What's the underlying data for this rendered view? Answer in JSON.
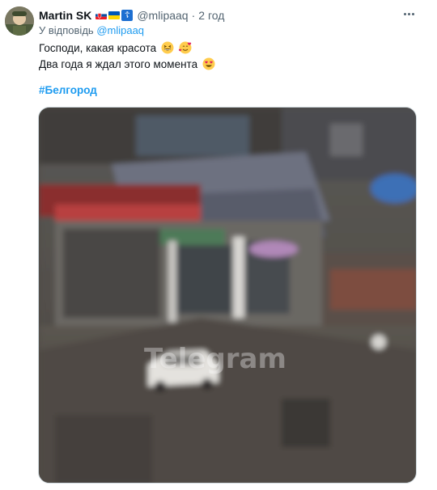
{
  "tweet": {
    "author": {
      "display_name": "Martin SK",
      "handle": "@mlipaaq",
      "avatar_icon": "avatar-photo",
      "badges": [
        "slovakia-flag-icon",
        "ukraine-flag-icon",
        "orthodox-cross-icon"
      ]
    },
    "separator": "·",
    "timestamp": "2 год",
    "reply": {
      "prefix": "У відповідь",
      "to": "@mlipaaq"
    },
    "text": {
      "line1": "Господи, какая красота",
      "line2": "Два года я ждал этого момента"
    },
    "line1_emojis": [
      "grinning-squinting-face-icon",
      "smiling-face-with-hearts-icon"
    ],
    "line2_emojis": [
      "heart-eyes-face-icon"
    ],
    "hashtag": "#Белгород",
    "media": {
      "type": "video",
      "watermark": "Telegram"
    }
  },
  "colors": {
    "text": "#0f1419",
    "secondary": "#536471",
    "link": "#1d9bf0",
    "border": "#cfd9de"
  }
}
